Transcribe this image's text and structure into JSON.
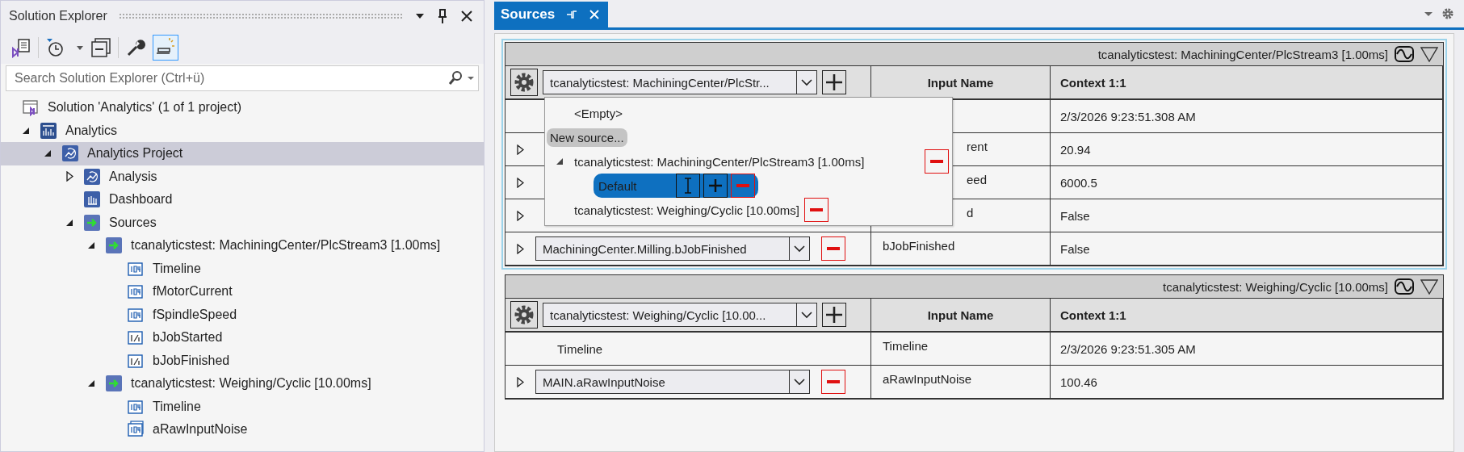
{
  "explorer": {
    "title": "Solution Explorer",
    "search": {
      "placeholder": "Search Solution Explorer (Ctrl+ü)"
    },
    "solution": {
      "label": "Solution 'Analytics' (1 of 1 project)"
    },
    "tree": [
      {
        "label": "Analytics",
        "kind": "analytics",
        "expanded": true,
        "selected": false,
        "children": [
          {
            "label": "Analytics Project",
            "kind": "project",
            "expanded": true,
            "selected": true,
            "children": [
              {
                "label": "Analysis",
                "kind": "analysis",
                "expanded": false,
                "selected": false
              },
              {
                "label": "Dashboard",
                "kind": "dashboard",
                "selected": false
              },
              {
                "label": "Sources",
                "kind": "sources",
                "expanded": true,
                "selected": false,
                "children": [
                  {
                    "label": "tcanalyticstest: MachiningCenter/PlcStream3 [1.00ms]",
                    "kind": "stream",
                    "expanded": true,
                    "selected": false,
                    "children": [
                      {
                        "label": "Timeline",
                        "kind": "f64",
                        "selected": false
                      },
                      {
                        "label": "fMotorCurrent",
                        "kind": "f64",
                        "selected": false
                      },
                      {
                        "label": "fSpindleSpeed",
                        "kind": "f64",
                        "selected": false
                      },
                      {
                        "label": "bJobStarted",
                        "kind": "bool",
                        "selected": false
                      },
                      {
                        "label": "bJobFinished",
                        "kind": "bool",
                        "selected": false
                      }
                    ]
                  },
                  {
                    "label": "tcanalyticstest: Weighing/Cyclic [10.00ms]",
                    "kind": "stream",
                    "expanded": true,
                    "selected": false,
                    "children": [
                      {
                        "label": "Timeline",
                        "kind": "f64",
                        "selected": false
                      },
                      {
                        "label": "aRawInputNoise",
                        "kind": "array",
                        "selected": false
                      }
                    ]
                  }
                ]
              }
            ]
          }
        ]
      }
    ]
  },
  "tabs": [
    {
      "label": "Sources",
      "selected": true
    }
  ],
  "panels": [
    {
      "title": "tcanalyticstest: MachiningCenter/PlcStream3 [1.00ms]",
      "focused": true,
      "source": "tcanalyticstest: MachiningCenter/PlcStr...",
      "columns": [
        "Input Name",
        "Context 1:1"
      ],
      "rows": [
        {
          "kind": "timeline",
          "value": "2/3/2026 9:23:51.308 AM"
        },
        {
          "kind": "covered",
          "input_name": "rent",
          "value": "20.94"
        },
        {
          "kind": "covered",
          "input_name": "eed",
          "value": "6000.5"
        },
        {
          "kind": "covered",
          "input_name": "d",
          "value": "False"
        },
        {
          "kind": "signal",
          "source": "MachiningCenter.Milling.bJobFinished",
          "input_name": "bJobFinished",
          "value": "False"
        }
      ],
      "popup": {
        "items": [
          {
            "kind": "plain",
            "label": "<Empty>",
            "selected": false
          },
          {
            "kind": "action",
            "label": "New source...",
            "selected": false
          },
          {
            "kind": "stream",
            "label": "tcanalyticstest: MachiningCenter/PlcStream3 [1.00ms]",
            "expanded": true,
            "selected": false,
            "children": [
              {
                "label": "Default",
                "selected": true
              }
            ]
          },
          {
            "kind": "stream",
            "label": "tcanalyticstest: Weighing/Cyclic [10.00ms]",
            "selected": false
          }
        ]
      }
    },
    {
      "title": "tcanalyticstest: Weighing/Cyclic [10.00ms]",
      "focused": false,
      "source": "tcanalyticstest: Weighing/Cyclic [10.00...",
      "columns": [
        "Input Name",
        "Context 1:1"
      ],
      "rows": [
        {
          "kind": "timeline",
          "label": "Timeline",
          "input_name": "Timeline",
          "value": "2/3/2026 9:23:51.305 AM"
        },
        {
          "kind": "signal",
          "source": "MAIN.aRawInputNoise",
          "input_name": "aRawInputNoise",
          "value": "100.46"
        }
      ]
    }
  ]
}
